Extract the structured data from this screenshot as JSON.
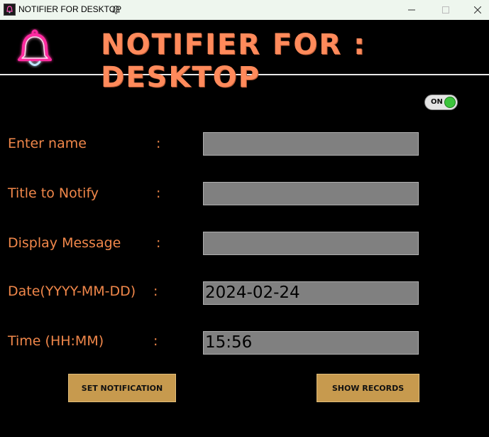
{
  "window": {
    "title": "NOTIFIER FOR DESKTOP",
    "controls": [
      "minimize-icon",
      "maximize-icon",
      "close-icon"
    ]
  },
  "banner": {
    "title": "NOTIFIER FOR : DESKTOP",
    "icon": "bell-icon",
    "colors": {
      "title": "#ff8a5b",
      "bell_outer": "#ff2aa0",
      "bell_inner": "#bfe6ff"
    }
  },
  "toggle": {
    "label": "ON",
    "state": "on"
  },
  "form": {
    "fields": [
      {
        "label": "Enter name",
        "value": ""
      },
      {
        "label": "Title to Notify",
        "value": ""
      },
      {
        "label": "Display Message",
        "value": ""
      },
      {
        "label": "Date(YYYY-MM-DD)",
        "value": "2024-02-24"
      },
      {
        "label": "Time (HH:MM)",
        "value": "15:56"
      }
    ],
    "separator": ":"
  },
  "buttons": {
    "set_notification": "SET NOTIFICATION",
    "show_records": "SHOW RECORDS"
  }
}
